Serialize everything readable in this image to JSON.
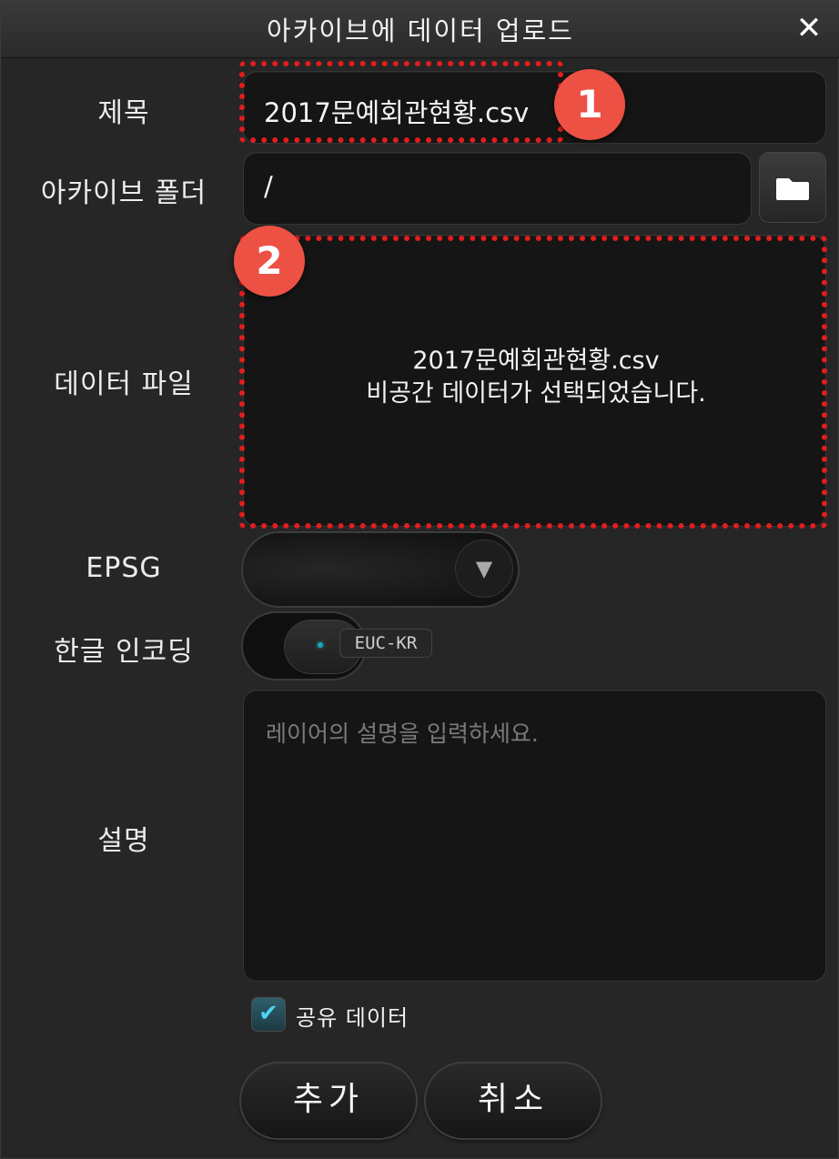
{
  "dialog": {
    "title": "아카이브에 데이터 업로드",
    "close_icon": "close-icon"
  },
  "form": {
    "title_label": "제목",
    "title_value": "2017문예회관현황.csv",
    "folder_label": "아카이브 폴더",
    "folder_value": "/",
    "folder_button_icon": "folder-icon",
    "datafile_label": "데이터 파일",
    "datafile_name": "2017문예회관현황.csv",
    "datafile_message": "비공간 데이터가 선택되었습니다.",
    "epsg_label": "EPSG",
    "epsg_value": "",
    "encoding_label": "한글 인코딩",
    "encoding_value": "EUC-KR",
    "description_label": "설명",
    "description_placeholder": "레이어의 설명을 입력하세요.",
    "shared_label": "공유 데이터",
    "shared_checked": true
  },
  "annotations": {
    "badge_1": "1",
    "badge_2": "2",
    "highlight_color": "#e21d1d",
    "badge_color": "#ec5144"
  },
  "buttons": {
    "add_label": "추가",
    "cancel_label": "취소"
  }
}
